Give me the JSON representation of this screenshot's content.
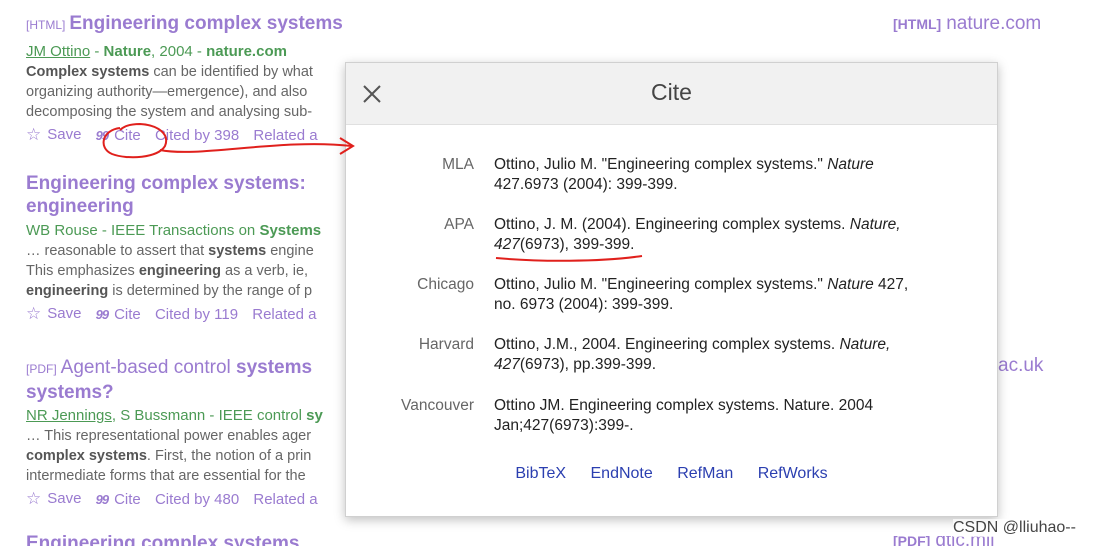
{
  "results": [
    {
      "tag": "[HTML]",
      "title": "Engineering complex systems",
      "authors_link": "JM Ottino",
      "meta_sep1": " - ",
      "source": "Nature",
      "year": ", 2004 - ",
      "domain": "nature.com",
      "snippet": [
        [
          "Complex systems",
          " can be identified by what"
        ],
        [
          "",
          "organizing authority—emergence), and also"
        ],
        [
          "",
          "decomposing the system and analysing sub-"
        ]
      ],
      "save": "Save",
      "cite": "Cite",
      "cited_by": "Cited by 398",
      "related": "Related a"
    },
    {
      "title_line1": "Engineering complex systems:",
      "title_line2": "engineering",
      "meta": "WB Rouse - IEEE Transactions on ",
      "meta_bold": "Systems",
      "snippet": [
        [
          "… reasonable to assert that ",
          "systems",
          " engine"
        ],
        [
          "This emphasizes ",
          "engineering",
          " as a verb, ie,"
        ],
        [
          "",
          "engineering",
          " is determined by the range of p"
        ]
      ],
      "save": "Save",
      "cite": "Cite",
      "cited_by": "Cited by 119",
      "related": "Related a"
    },
    {
      "tag": "[PDF]",
      "title_pre": "Agent-based control ",
      "title_bold": "systems",
      "title_line2": "systems?",
      "authors_link": "NR Jennings",
      "meta_rest": ", S Bussmann - IEEE control ",
      "meta_bold": "sy",
      "snippet": [
        [
          "… This representational power enables ager",
          "",
          ""
        ],
        [
          "",
          "complex systems",
          ". First, the notion of a prin"
        ],
        [
          "intermediate forms that are essential for the",
          "",
          ""
        ]
      ],
      "save": "Save",
      "cite": "Cite",
      "cited_by": "Cited by 480",
      "related": "Related a"
    },
    {
      "title_partial": "Engineering complex systems"
    }
  ],
  "side_links": [
    {
      "tag": "[HTML]",
      "text": "nature.com"
    },
    {
      "text": "ac.uk"
    },
    {
      "tag": "[PDF]",
      "text": "dtic.mil"
    }
  ],
  "modal": {
    "title": "Cite",
    "close_icon": "close-icon",
    "citations": [
      {
        "style": "MLA",
        "line1_pre": "Ottino, Julio M. \"Engineering complex systems.\" ",
        "line1_ital": "Nature",
        "line2": "427.6973 (2004): 399-399."
      },
      {
        "style": "APA",
        "line1_pre": "Ottino, J. M. (2004). Engineering complex systems. ",
        "line1_ital": "Nature,",
        "line2_ital": "427",
        "line2": "(6973), 399-399."
      },
      {
        "style": "Chicago",
        "line1_pre": "Ottino, Julio M. \"Engineering complex systems.\" ",
        "line1_ital": "Nature",
        "line1_post": " 427,",
        "line2": "no. 6973 (2004): 399-399."
      },
      {
        "style": "Harvard",
        "line1_pre": "Ottino, J.M., 2004. Engineering complex systems. ",
        "line1_ital": "Nature,",
        "line2_ital": "427",
        "line2": "(6973), pp.399-399."
      },
      {
        "style": "Vancouver",
        "line1_pre": "Ottino JM. Engineering complex systems. Nature. 2004",
        "line2": "Jan;427(6973):399-."
      }
    ],
    "exports": [
      "BibTeX",
      "EndNote",
      "RefMan",
      "RefWorks"
    ]
  },
  "watermark": "CSDN @lliuhao--",
  "colors": {
    "link": "#9a7bd0",
    "green": "#4c9a55",
    "export": "#2b3fb0",
    "annotation": "#e0201c"
  }
}
